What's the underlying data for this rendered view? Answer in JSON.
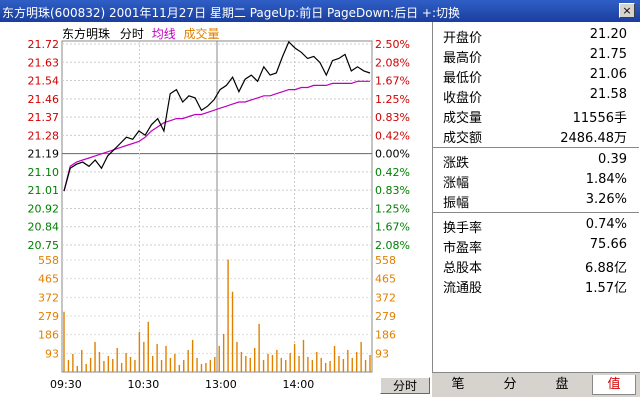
{
  "window": {
    "title": "东方明珠(600832) 2001年11月27日 星期二 PageUp:前日 PageDown:后日 +:切换",
    "close_label": "×"
  },
  "chart": {
    "stock_name": "东方明珠",
    "mode_label": "分时",
    "avg_label": "均线",
    "vol_label": "成交量",
    "button_label": "分时",
    "colors": {
      "price": "#000000",
      "avg": "#c000c0",
      "vol": "#e08000",
      "up": "#d00000",
      "down": "#008000"
    }
  },
  "chart_data": {
    "type": "line",
    "xlabels": [
      "09:30",
      "10:30",
      "13:00",
      "14:00"
    ],
    "price_ticks": [
      "21.72",
      "21.63",
      "21.54",
      "21.46",
      "21.37",
      "21.28",
      "21.19",
      "21.10",
      "21.01",
      "20.92",
      "20.84",
      "20.75"
    ],
    "pct_ticks": [
      "2.50%",
      "2.08%",
      "1.67%",
      "1.25%",
      "0.83%",
      "0.42%",
      "0.00%",
      "0.42%",
      "0.83%",
      "1.25%",
      "1.67%",
      "2.08%"
    ],
    "vol_ticks": [
      "558",
      "465",
      "372",
      "279",
      "186",
      "93"
    ],
    "price_range": [
      20.75,
      21.72
    ],
    "vol_max": 558,
    "price_series": {
      "name": "价格",
      "values": [
        21.01,
        21.12,
        21.14,
        21.15,
        21.13,
        21.16,
        21.12,
        21.18,
        21.21,
        21.24,
        21.27,
        21.26,
        21.3,
        21.28,
        21.33,
        21.36,
        21.3,
        21.48,
        21.5,
        21.44,
        21.47,
        21.46,
        21.4,
        21.42,
        21.45,
        21.5,
        21.52,
        21.56,
        21.49,
        21.55,
        21.57,
        21.54,
        21.61,
        21.57,
        21.58,
        21.66,
        21.73,
        21.7,
        21.68,
        21.65,
        21.66,
        21.63,
        21.57,
        21.64,
        21.65,
        21.67,
        21.59,
        21.61,
        21.59,
        21.58
      ]
    },
    "avg_series": {
      "name": "均线",
      "values": [
        21.01,
        21.13,
        21.15,
        21.16,
        21.17,
        21.18,
        21.19,
        21.2,
        21.21,
        21.22,
        21.23,
        21.24,
        21.25,
        21.27,
        21.3,
        21.32,
        21.34,
        21.35,
        21.36,
        21.36,
        21.37,
        21.38,
        21.38,
        21.39,
        21.4,
        21.41,
        21.42,
        21.43,
        21.44,
        21.44,
        21.45,
        21.46,
        21.47,
        21.47,
        21.48,
        21.49,
        21.5,
        21.5,
        21.51,
        21.51,
        21.52,
        21.52,
        21.52,
        21.53,
        21.53,
        21.53,
        21.53,
        21.54,
        21.54,
        21.54
      ]
    },
    "volume": [
      300,
      60,
      90,
      30,
      110,
      40,
      70,
      150,
      100,
      55,
      80,
      65,
      120,
      45,
      95,
      75,
      60,
      200,
      150,
      250,
      80,
      140,
      60,
      130,
      70,
      90,
      35,
      60,
      110,
      160,
      70,
      40,
      45,
      60,
      75,
      130,
      190,
      560,
      400,
      150,
      100,
      80,
      70,
      120,
      240,
      60,
      90,
      85,
      110,
      70,
      60,
      95,
      140,
      80,
      160,
      75,
      60,
      100,
      70,
      45,
      55,
      130,
      80,
      65,
      110,
      70,
      100,
      150,
      60,
      85
    ]
  },
  "panel": {
    "quote": [
      {
        "label": "开盘价",
        "value": "21.20"
      },
      {
        "label": "最高价",
        "value": "21.75"
      },
      {
        "label": "最低价",
        "value": "21.06"
      },
      {
        "label": "收盘价",
        "value": "21.58"
      },
      {
        "label": "成交量",
        "value": "11556手"
      },
      {
        "label": "成交额",
        "value": "2486.48万"
      }
    ],
    "change": [
      {
        "label": "涨跌",
        "value": "0.39"
      },
      {
        "label": "涨幅",
        "value": "1.84%"
      },
      {
        "label": "振幅",
        "value": "3.26%"
      }
    ],
    "stats": [
      {
        "label": "换手率",
        "value": "0.74%"
      },
      {
        "label": "市盈率",
        "value": "75.66"
      },
      {
        "label": "总股本",
        "value": "6.88亿"
      },
      {
        "label": "流通股",
        "value": "1.57亿"
      }
    ]
  },
  "tabs": [
    {
      "label": "笔"
    },
    {
      "label": "分"
    },
    {
      "label": "盘"
    },
    {
      "label": "值"
    }
  ]
}
